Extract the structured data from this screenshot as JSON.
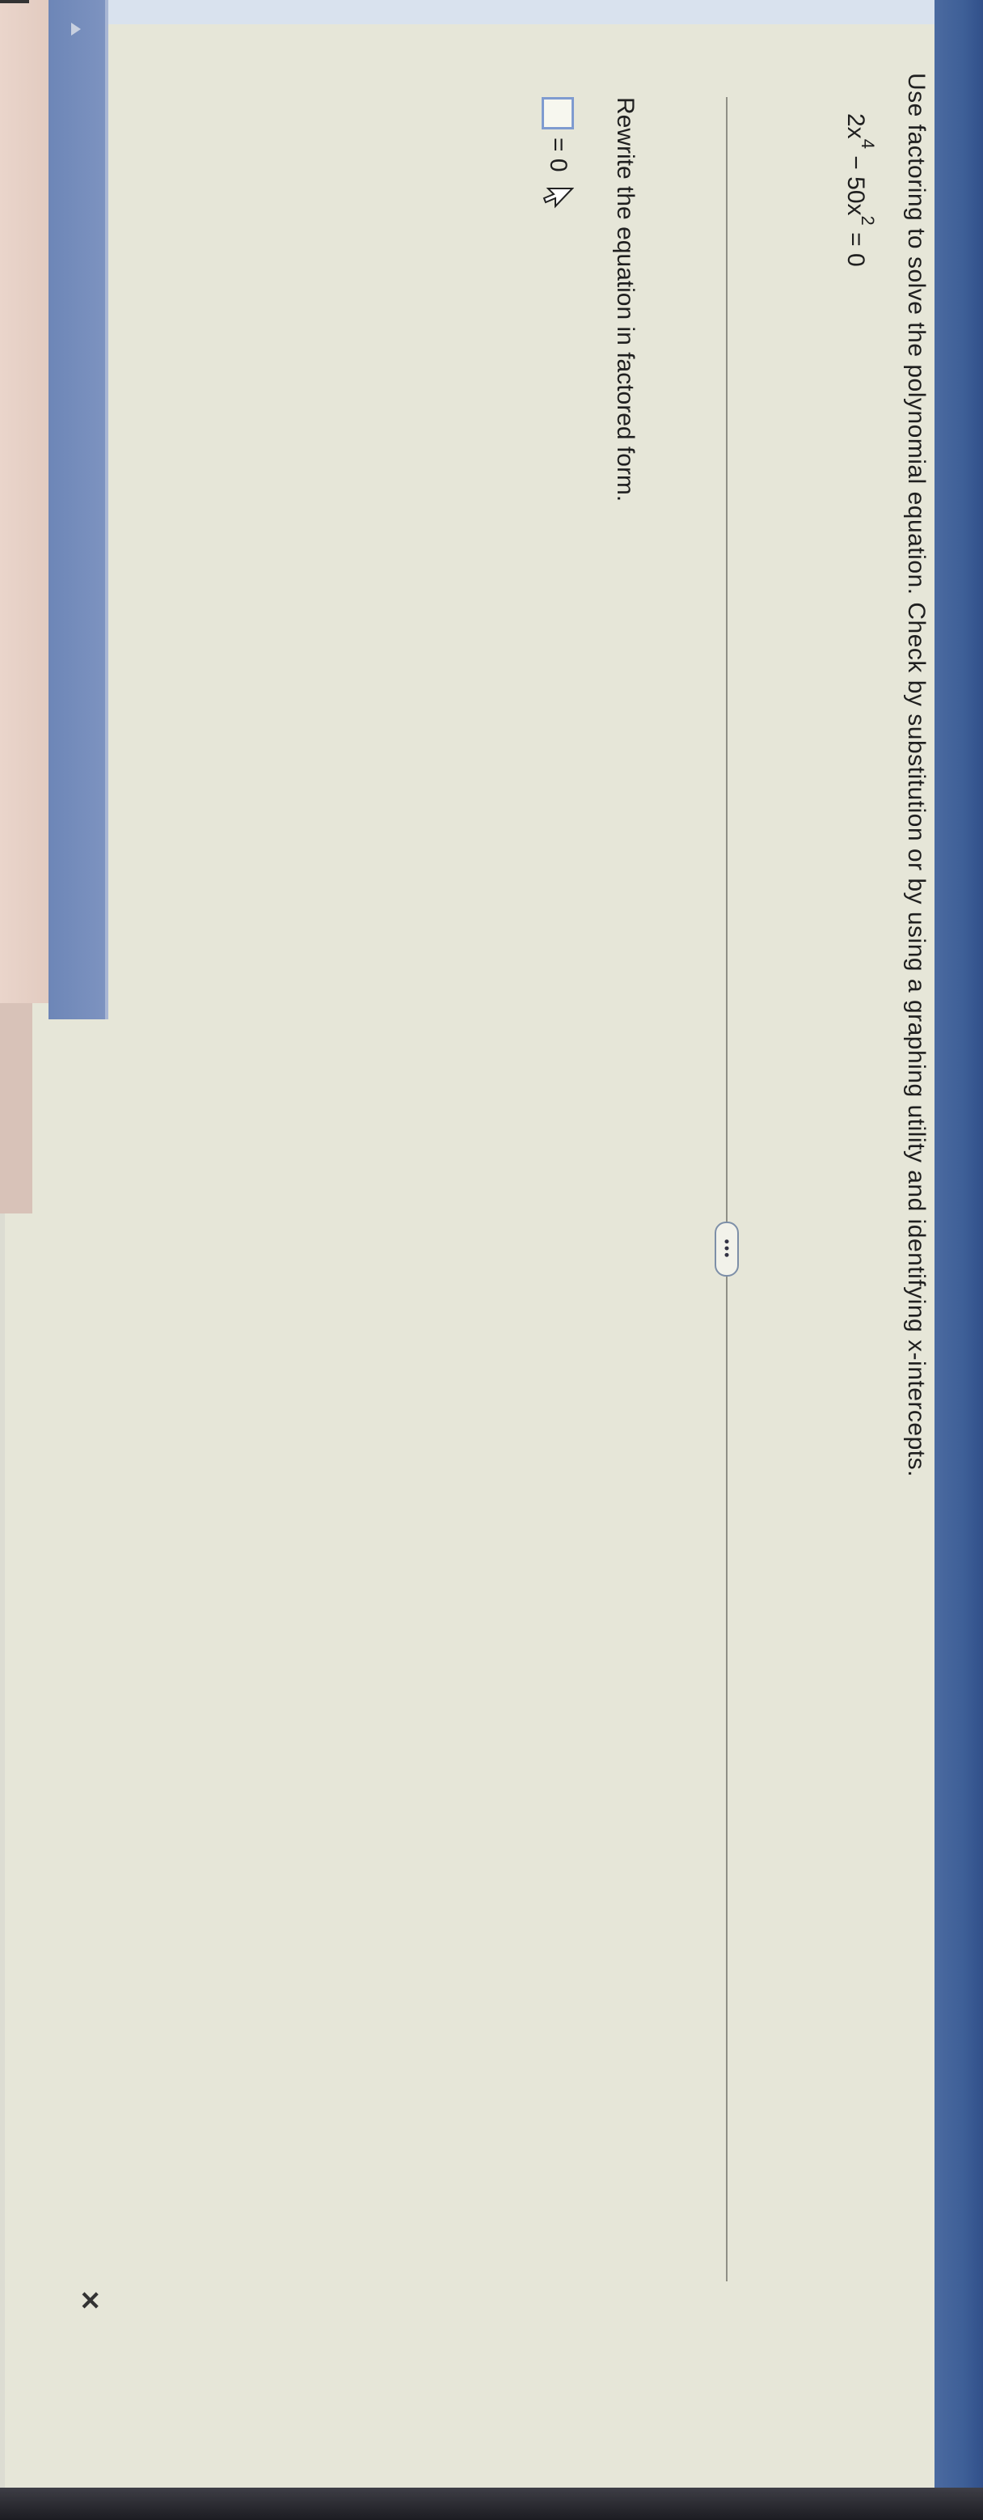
{
  "problem": {
    "prompt": "Use factoring to solve the polynomial equation. Check by substitution or by using a graphing utility and identifying x-intercepts.",
    "equation": {
      "term1_coef": "2x",
      "term1_exp": "4",
      "term2": "− 50x",
      "term2_exp": "2",
      "rhs": "= 0"
    }
  },
  "more_button": {
    "label": "•••"
  },
  "step": {
    "instruction": "Rewrite the equation in factored form.",
    "answer_rhs": "= 0",
    "answer_value": ""
  },
  "icons": {
    "close": "close-icon",
    "cursor": "pointer-cursor-icon",
    "expand": "chevron-right-icon"
  },
  "colors": {
    "page_background": "#e6e6d8",
    "answer_box_border": "#7f9bd0",
    "bezel": "#3e5f97"
  }
}
